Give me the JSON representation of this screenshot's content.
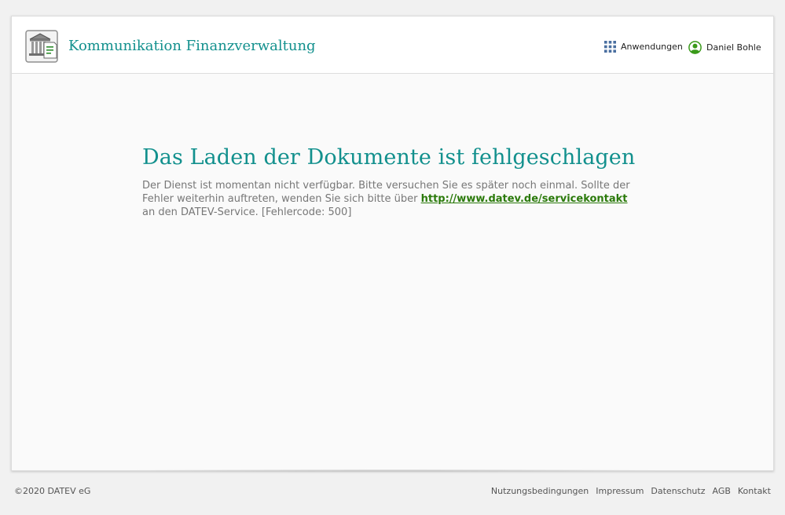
{
  "header": {
    "app_title": "Kommunikation Finanzverwaltung",
    "apps_label": "Anwendungen",
    "user_name": "Daniel Bohle"
  },
  "error": {
    "title": "Das Laden der Dokumente ist fehlgeschlagen",
    "message_before": "Der Dienst ist momentan nicht verfügbar. Bitte versuchen Sie es später noch einmal. Sollte der Fehler weiterhin auftreten, wenden Sie sich bitte über ",
    "link_text": "http://www.datev.de/servicekontakt",
    "message_after": " an den DATEV-Service. [Fehlercode: 500]"
  },
  "footer": {
    "copyright": "©2020 DATEV eG",
    "links": [
      "Nutzungsbedingungen",
      "Impressum",
      "Datenschutz",
      "AGB",
      "Kontakt"
    ]
  },
  "colors": {
    "accent": "#12908d",
    "link": "#2b7a0b",
    "user_icon": "#3a9a1a"
  },
  "icons": {
    "logo": "tax-office-building-document-icon",
    "apps": "grid-apps-icon",
    "user": "user-avatar-icon"
  }
}
